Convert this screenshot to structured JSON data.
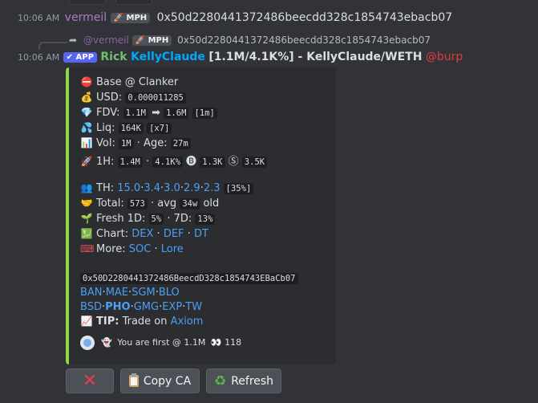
{
  "message1": {
    "time": "10:06 AM",
    "username": "vermeil",
    "badge": "MPH",
    "text": "0x50d2280441372486beecdd328c1854743ebacb07"
  },
  "reply": {
    "arrow": "➦",
    "username": "@vermeil",
    "badge": "MPH",
    "text": "0x50d2280441372486beecdd328c1854743ebacb07"
  },
  "message2": {
    "time": "10:06 AM",
    "badge": "APP",
    "username": "Rick",
    "token_link": "KellyClaude",
    "summary": "[1.1M/4.1K%] - KellyClaude/WETH",
    "mention": "@burp"
  },
  "embed": {
    "chain": "Base @ Clanker",
    "usd_label": "USD:",
    "usd_value": "0.000011285",
    "fdv_label": "FDV:",
    "fdv_from": "1.1M",
    "fdv_arrow": "➡",
    "fdv_to": "1.6M",
    "fdv_period": "[1m]",
    "liq_label": "Liq:",
    "liq_value": "164K",
    "liq_mult": "[x7]",
    "vol_label": "Vol:",
    "vol_value": "1M",
    "age_label": "· Age:",
    "age_value": "27m",
    "h1_label": "1H:",
    "h1_value": "1.4M",
    "h1_sep": "·",
    "h1_pct": "4.1K%",
    "h1_buys": "1.3K",
    "h1_sells": "3.5K",
    "th_label": "TH:",
    "th_values": [
      "15.0",
      "3.4",
      "3.0",
      "2.9",
      "2.3"
    ],
    "th_total": "[35%]",
    "total_label": "Total:",
    "total_value": "573",
    "avg_label": "· avg",
    "avg_value": "34w",
    "avg_suffix": "old",
    "fresh_label": "Fresh 1D:",
    "fresh_1d": "5%",
    "fresh_sep": "· 7D:",
    "fresh_7d": "13%",
    "chart_label": "Chart:",
    "chart_links": [
      "DEX",
      "DEF",
      "DT"
    ],
    "more_label": "More:",
    "more_links": [
      "SOC",
      "Lore"
    ],
    "contract": "0x50D2280441372486BeecdD328c1854743EBaCb07",
    "bot_links_1": [
      "BAN",
      "MAE",
      "SGM",
      "BLO"
    ],
    "bot_links_2": [
      "BSD",
      "PHO",
      "GMG",
      "EXP",
      "TW"
    ],
    "tip_label": "TIP:",
    "tip_text": "Trade on",
    "tip_link": "Axiom",
    "footer_text": "You are first @ 1.1M",
    "footer_count": "118"
  },
  "buttons": {
    "close": "✕",
    "copy": "Copy CA",
    "refresh": "Refresh"
  },
  "colors": {
    "background": "#313338",
    "embed_bg": "#2b2d31",
    "embed_accent": "#8ed84a",
    "link": "#00a8fc",
    "mention": "#e03c3c"
  }
}
